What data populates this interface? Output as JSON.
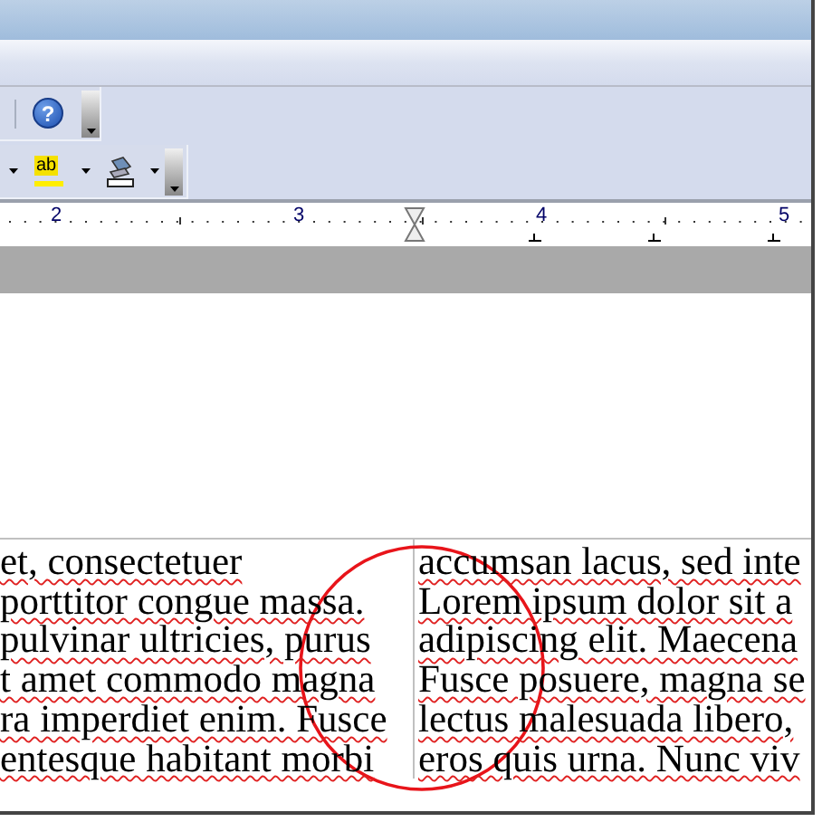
{
  "toolbar_1": {
    "help_button": "?"
  },
  "toolbar_2": {
    "highlight_button": "ab"
  },
  "ruler": {
    "numbers": [
      "2",
      "3",
      "4",
      "5"
    ]
  },
  "table": {
    "columns": [
      {
        "lines": [
          "et, consectetuer",
          "porttitor congue massa.",
          "pulvinar ultricies, purus",
          "t amet commodo magna",
          "ra imperdiet enim. Fusce",
          "entesque habitant morbi"
        ]
      },
      {
        "lines": [
          "accumsan lacus, sed inte",
          "Lorem ipsum dolor sit a",
          "adipiscing elit. Maecena",
          "Fusce posuere, magna se",
          "lectus malesuada libero,",
          "eros quis urna. Nunc viv"
        ]
      }
    ]
  }
}
